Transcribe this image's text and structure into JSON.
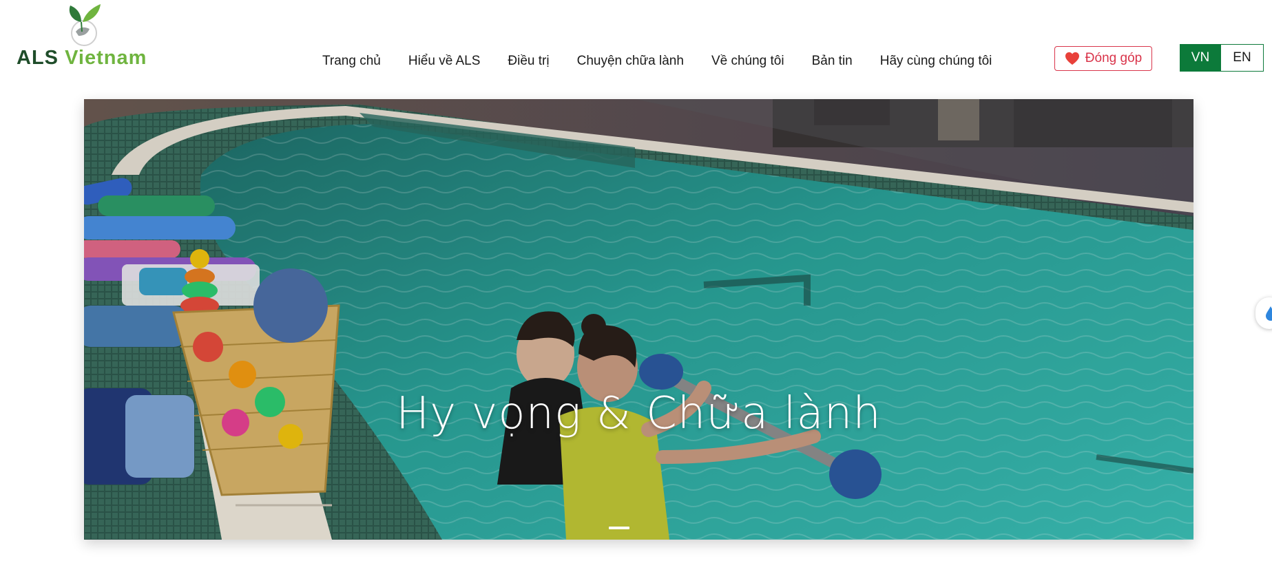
{
  "header": {
    "logo": {
      "text_als": "ALS",
      "text_country": "Vietnam"
    },
    "nav": [
      {
        "label": "Trang chủ"
      },
      {
        "label": "Hiểu về ALS"
      },
      {
        "label": "Điều trị"
      },
      {
        "label": "Chuyện chữa lành"
      },
      {
        "label": "Về chúng tôi"
      },
      {
        "label": "Bản tin"
      },
      {
        "label": "Hãy cùng chúng tôi"
      }
    ],
    "donate_label": "Đóng góp",
    "languages": {
      "active": "VN",
      "other": "EN"
    }
  },
  "hero": {
    "title": "Hy vọng & Chữa lành",
    "slider": {
      "current": 1
    }
  },
  "colors": {
    "brand_green": "#0c7a3a",
    "logo_dark": "#1f4d2a",
    "logo_light": "#6fb43f",
    "donate_red": "#d9344a",
    "pool_water": "#2aa39a"
  },
  "icons": {
    "logo": "leaf-globe-icon",
    "donate": "heart-icon",
    "widget": "water-drop-icon"
  }
}
